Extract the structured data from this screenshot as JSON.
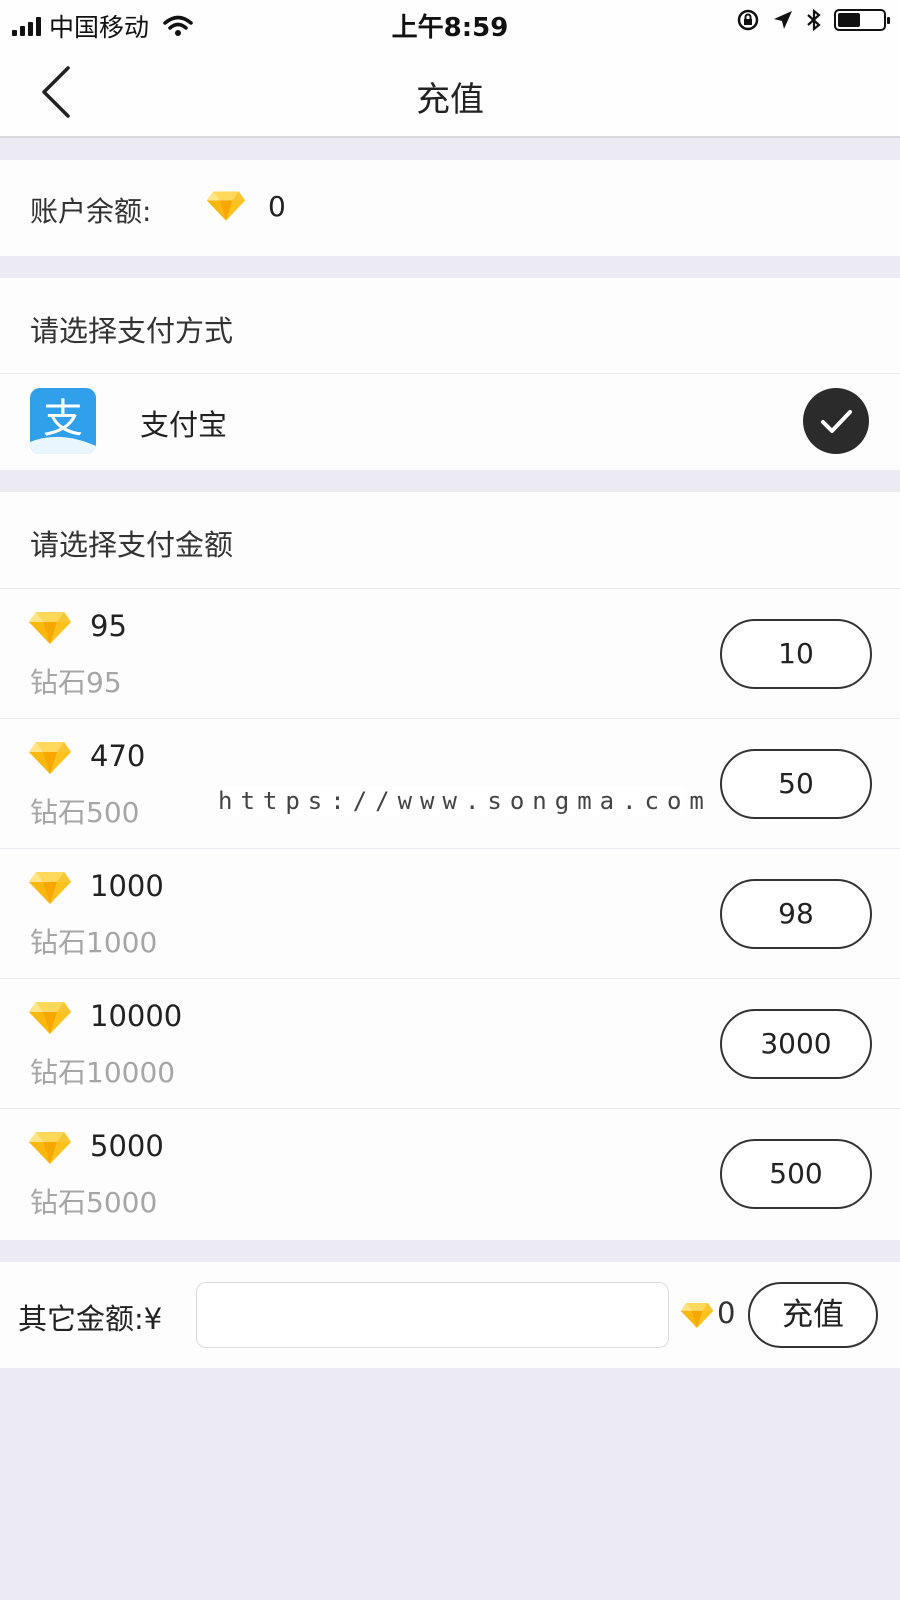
{
  "status_bar": {
    "carrier": "中国移动",
    "time": "上午8:59",
    "battery_level": 0.5
  },
  "nav": {
    "title": "充值",
    "back_icon": "chevron-left-icon"
  },
  "balance": {
    "label": "账户余额:",
    "value": "0",
    "icon": "diamond-icon"
  },
  "pay_method": {
    "heading": "请选择支付方式",
    "options": [
      {
        "name": "支付宝",
        "icon": "alipay-icon",
        "selected": true
      }
    ]
  },
  "pay_amount": {
    "heading": "请选择支付金额",
    "packages": [
      {
        "amount": "95",
        "sub": "钻石95",
        "price": "10"
      },
      {
        "amount": "470",
        "sub": "钻石500",
        "price": "50"
      },
      {
        "amount": "1000",
        "sub": "钻石1000",
        "price": "98"
      },
      {
        "amount": "10000",
        "sub": "钻石10000",
        "price": "3000"
      },
      {
        "amount": "5000",
        "sub": "钻石5000",
        "price": "500"
      }
    ]
  },
  "other": {
    "label": "其它金额:¥",
    "input_value": "",
    "gem_value": "0",
    "submit_label": "充值"
  },
  "watermark": "https://www.songma.com",
  "colors": {
    "diamond": "#f7b500",
    "alipay": "#2fa0e9",
    "background": "#eceaf3"
  }
}
